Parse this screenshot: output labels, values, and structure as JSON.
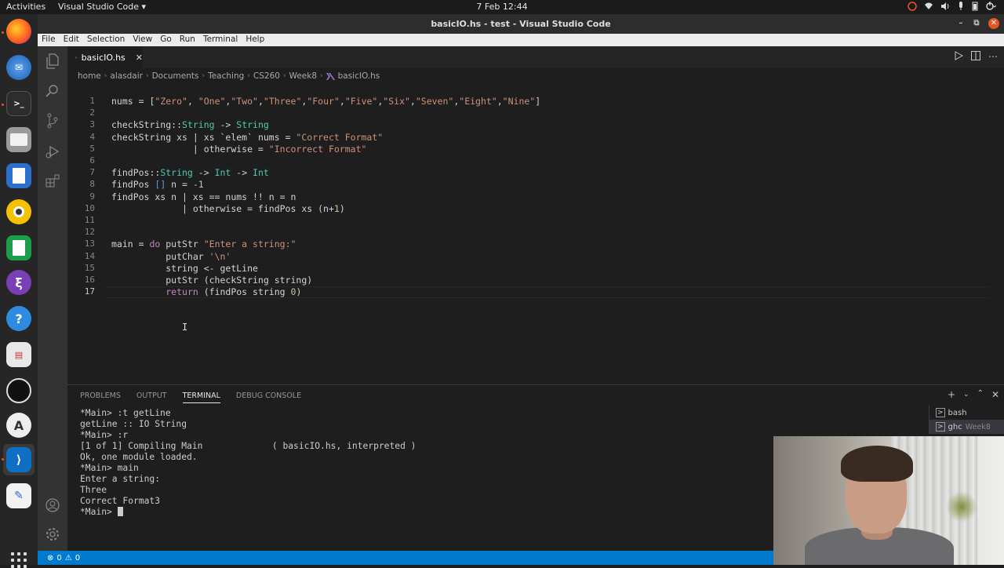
{
  "topbar": {
    "activities": "Activities",
    "app_menu": "Visual Studio Code ▾",
    "clock": "7 Feb  12:44",
    "tray_icons": [
      "network-status-icon",
      "wifi-icon",
      "volume-icon",
      "microphone-icon",
      "battery-icon",
      "power-icon"
    ]
  },
  "dock": {
    "apps": [
      "firefox-icon",
      "thunderbird-icon",
      "terminal-icon",
      "files-icon",
      "writer-icon",
      "rhythmbox-icon",
      "calc-icon",
      "emacs-icon",
      "help-icon",
      "text-editor-icon",
      "obs-icon",
      "software-center-icon",
      "vscode-icon",
      "gedit-icon"
    ]
  },
  "window": {
    "title": "basicIO.hs - test - Visual Studio Code",
    "controls": {
      "minimize": "–",
      "restore": "⧉",
      "close": "✕"
    }
  },
  "menubar": [
    "File",
    "Edit",
    "Selection",
    "View",
    "Go",
    "Run",
    "Terminal",
    "Help"
  ],
  "tab": {
    "label": "basicIO.hs",
    "close": "✕"
  },
  "breadcrumb": [
    "home",
    "alasdair",
    "Documents",
    "Teaching",
    "CS260",
    "Week8",
    "basicIO.hs"
  ],
  "editor": {
    "current_line": 17,
    "lines": [
      "nums = [\"Zero\", \"One\",\"Two\",\"Three\",\"Four\",\"Five\",\"Six\",\"Seven\",\"Eight\",\"Nine\"]",
      "",
      "checkString::String -> String",
      "checkString xs | xs `elem` nums = \"Correct Format\"",
      "               | otherwise = \"Incorrect Format\"",
      "",
      "findPos::String -> Int -> Int",
      "findPos [] n = -1",
      "findPos xs n | xs == nums !! n = n",
      "             | otherwise = findPos xs (n+1)",
      "",
      "",
      "main = do putStr \"Enter a string:\"",
      "          putChar '\\n'",
      "          string <- getLine",
      "          putStr (checkString string)",
      "          return (findPos string 0)"
    ]
  },
  "panel": {
    "tabs": [
      "PROBLEMS",
      "OUTPUT",
      "TERMINAL",
      "DEBUG CONSOLE"
    ],
    "active_tab": "TERMINAL",
    "terminal_lines": [
      "*Main> :t getLine",
      "getLine :: IO String",
      "*Main> :r",
      "[1 of 1] Compiling Main             ( basicIO.hs, interpreted )",
      "Ok, one module loaded.",
      "*Main> main",
      "Enter a string:",
      "Three",
      "Correct Format3",
      "*Main> "
    ],
    "sessions": [
      {
        "name": "bash",
        "detail": ""
      },
      {
        "name": "ghc",
        "detail": "Week8"
      }
    ]
  },
  "statusbar": {
    "errors": "0",
    "warnings": "0"
  },
  "colors": {
    "accent": "#007acc",
    "ubuntu_orange": "#e95420"
  }
}
